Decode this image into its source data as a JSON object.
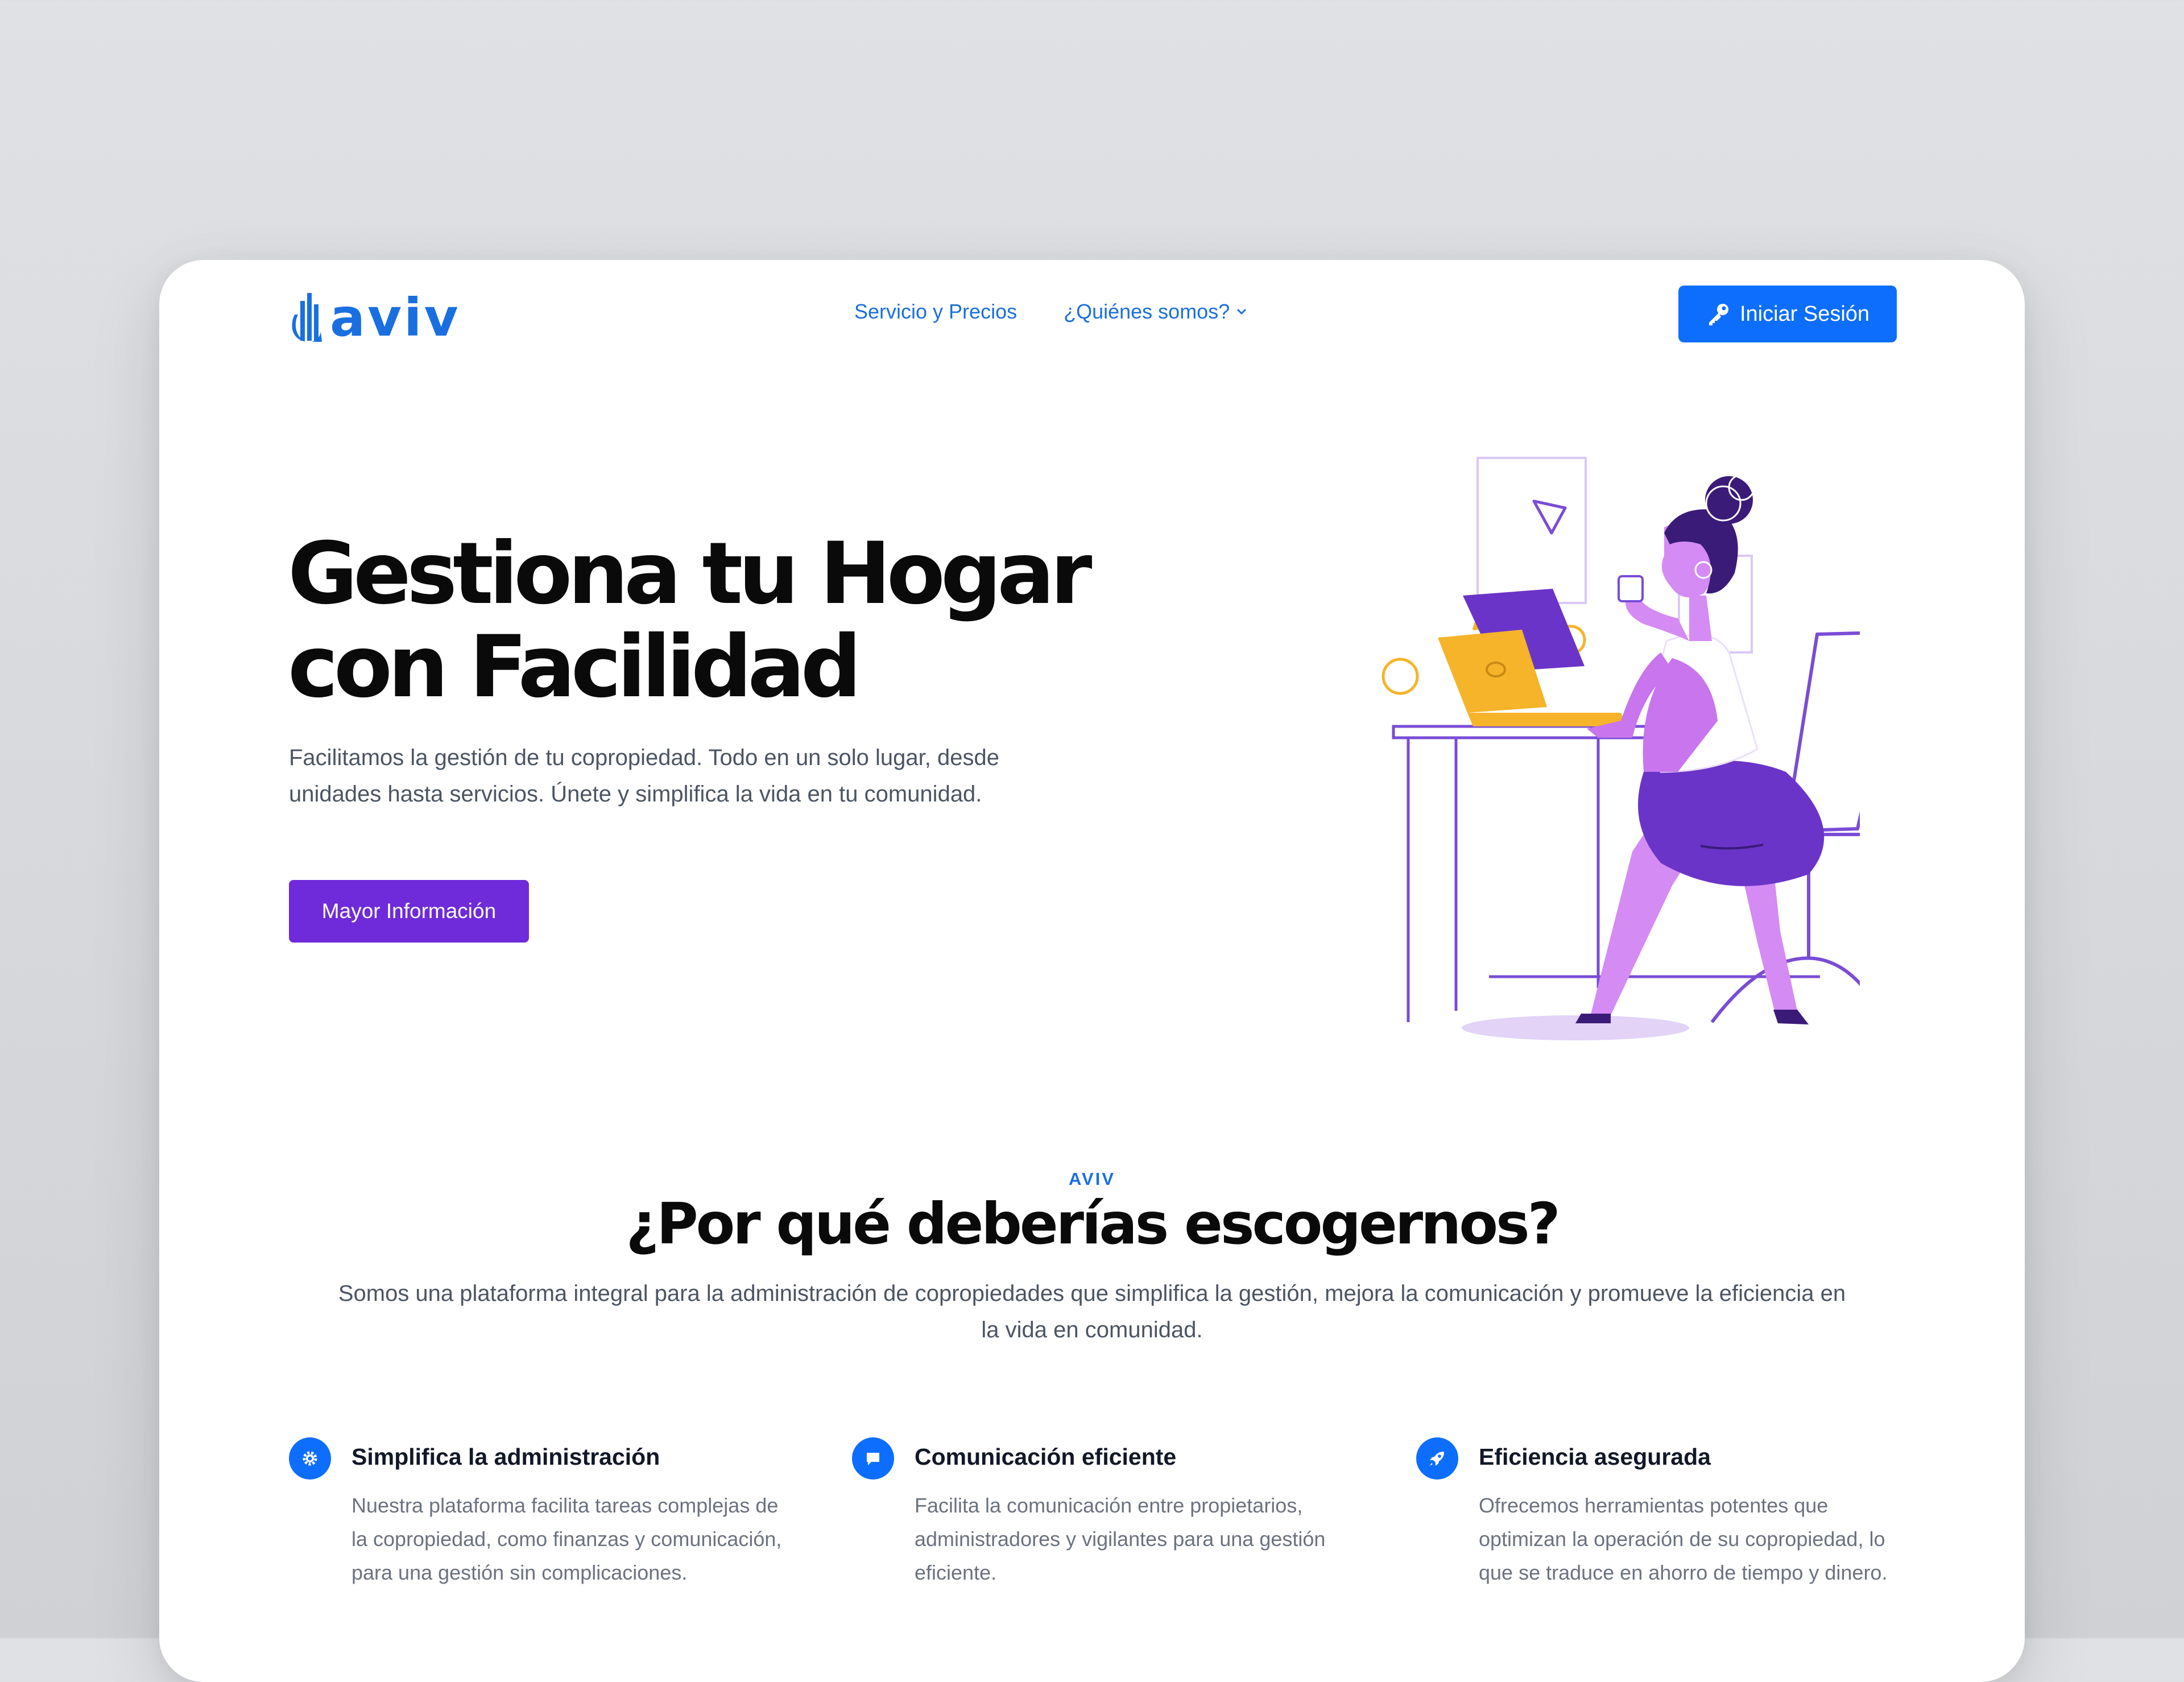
{
  "header": {
    "logo_text": "aviv",
    "nav": [
      {
        "label": "Servicio y Precios"
      },
      {
        "label": "¿Quiénes somos?"
      }
    ],
    "login_label": "Iniciar Sesión"
  },
  "hero": {
    "title_line1": "Gestiona tu Hogar",
    "title_line2": "con Facilidad",
    "description": "Facilitamos la gestión de tu copropiedad. Todo en un solo lugar, desde unidades hasta servicios. Únete y simplifica la vida en tu comunidad.",
    "cta_label": "Mayor Información"
  },
  "why": {
    "eyebrow": "AVIV",
    "title": "¿Por qué deberías escogernos?",
    "description": "Somos una plataforma integral para la administración de copropiedades que simplifica la gestión, mejora la comunicación y promueve la eficiencia en la vida en comunidad.",
    "features": [
      {
        "icon": "gear-icon",
        "title": "Simplifica la administración",
        "text": "Nuestra plataforma facilita tareas complejas de la copropiedad, como finanzas y comunicación, para una gestión sin complicaciones."
      },
      {
        "icon": "chat-icon",
        "title": "Comunicación eficiente",
        "text": "Facilita la comunicación entre propietarios, administradores y vigilantes para una gestión eficiente."
      },
      {
        "icon": "rocket-icon",
        "title": "Eficiencia asegurada",
        "text": "Ofrecemos herramientas potentes que optimizan la operación de su copropiedad, lo que se traduce en ahorro de tiempo y dinero."
      }
    ]
  },
  "colors": {
    "primary_blue": "#0d6efd",
    "link_blue": "#1a6fe0",
    "purple": "#6f2bd9",
    "illustration_yellow": "#f5b42a"
  }
}
